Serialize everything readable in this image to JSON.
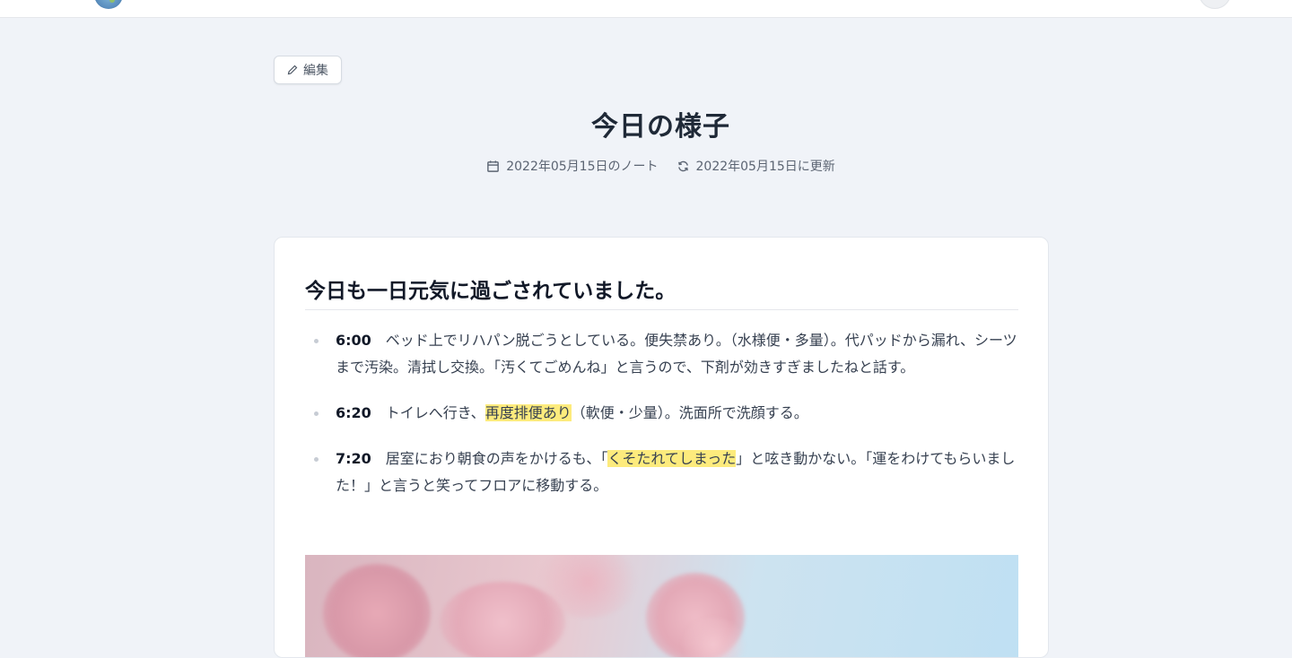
{
  "header": {
    "logo_icon": "globe-logo",
    "avatar_icon": "user-avatar"
  },
  "toolbar": {
    "edit_label": "編集",
    "edit_icon": "pencil-icon"
  },
  "page": {
    "title": "今日の様子",
    "note_date": "2022年05月15日のノート",
    "updated_date": "2022年05月15日に更新",
    "note_icon": "calendar-icon",
    "update_icon": "refresh-icon"
  },
  "content": {
    "heading": "今日も一日元気に過ごされていました。",
    "entries": [
      {
        "time": "6:00",
        "text": "ベッド上でリハパン脱ごうとしている。便失禁あり。（水様便・多量）。代パッドから漏れ、シーツまで汚染。清拭し交換。「汚くてごめんね」と言うので、下剤が効きすぎましたねと話す。"
      },
      {
        "time": "6:20",
        "before": "トイレへ行き、",
        "highlight": "再度排便あり",
        "after": "（軟便・少量）。洗面所で洗顔する。"
      },
      {
        "time": "7:20",
        "before": "居室におり朝食の声をかけるも、「",
        "highlight": "くそたれてしまった",
        "after": "」と呟き動かない。「運をわけてもらいました！」と言うと笑ってフロアに移動する。"
      }
    ],
    "photo_subject": "cherry-blossom-photo"
  },
  "colors": {
    "background": "#f0f3f8",
    "card": "#ffffff",
    "highlight": "#fdeb7d",
    "text": "#374151"
  }
}
